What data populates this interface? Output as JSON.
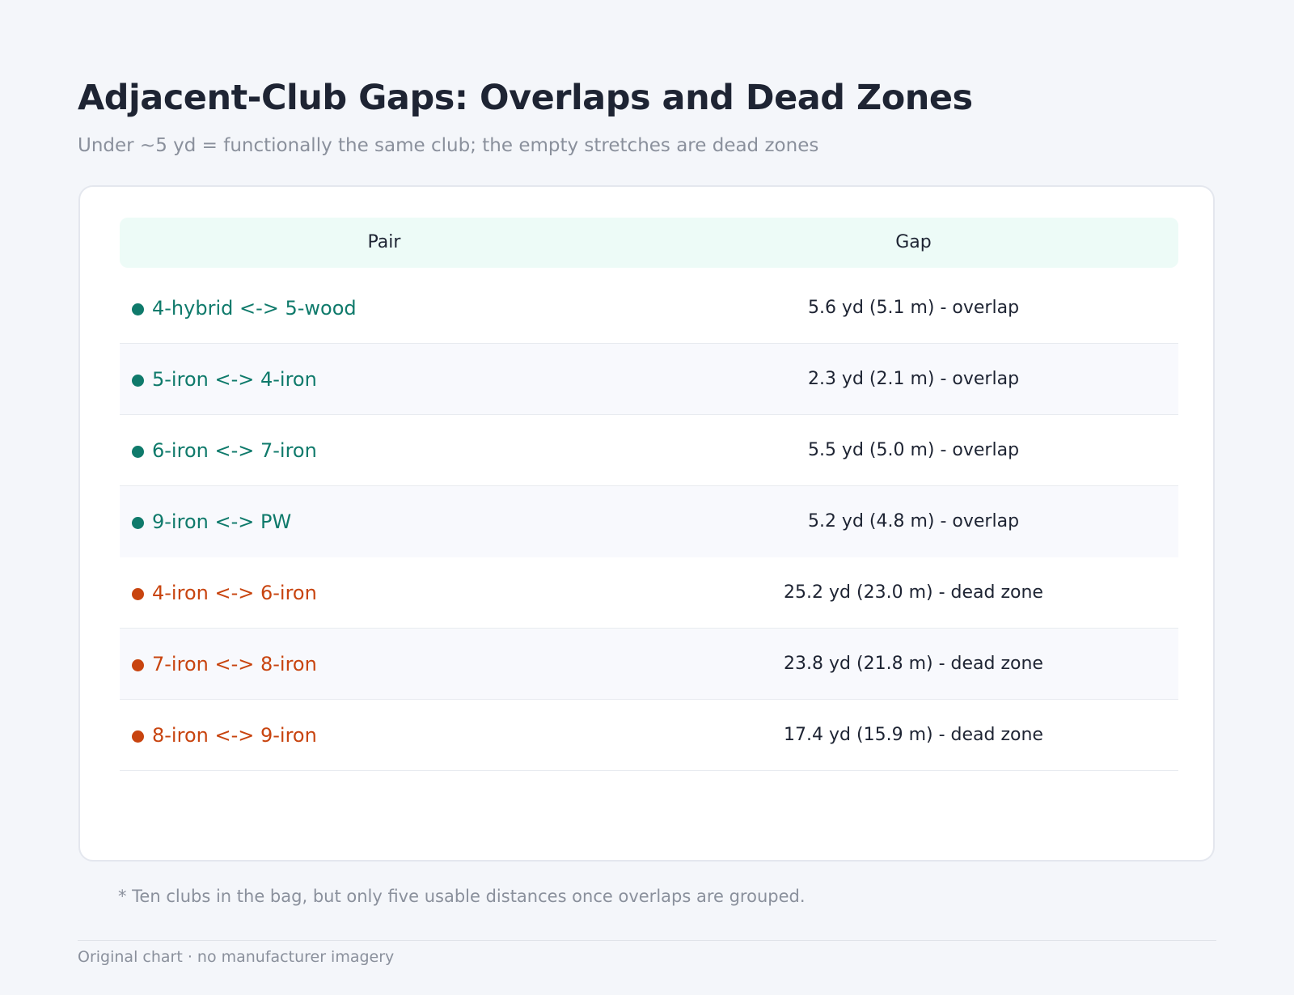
{
  "title": "Adjacent-Club Gaps: Overlaps and Dead Zones",
  "subtitle": "Under ~5 yd = functionally the same club; the empty stretches are dead zones",
  "colors": {
    "overlap": "#0f7a6b",
    "dead_zone": "#c8440f"
  },
  "chart_data": {
    "type": "table",
    "columns": [
      "Pair",
      "Gap"
    ],
    "rows": [
      {
        "pair": "4-hybrid <-> 5-wood",
        "gap": "5.6 yd (5.1 m) - overlap",
        "category": "overlap",
        "gap_yd": 5.6,
        "gap_m": 5.1
      },
      {
        "pair": "5-iron <-> 4-iron",
        "gap": "2.3 yd (2.1 m) - overlap",
        "category": "overlap",
        "gap_yd": 2.3,
        "gap_m": 2.1
      },
      {
        "pair": "6-iron <-> 7-iron",
        "gap": "5.5 yd (5.0 m) - overlap",
        "category": "overlap",
        "gap_yd": 5.5,
        "gap_m": 5.0
      },
      {
        "pair": "9-iron <-> PW",
        "gap": "5.2 yd (4.8 m) - overlap",
        "category": "overlap",
        "gap_yd": 5.2,
        "gap_m": 4.8
      },
      {
        "pair": "4-iron <-> 6-iron",
        "gap": "25.2 yd (23.0 m) - dead zone",
        "category": "dead_zone",
        "gap_yd": 25.2,
        "gap_m": 23.0
      },
      {
        "pair": "7-iron <-> 8-iron",
        "gap": "23.8 yd (21.8 m) - dead zone",
        "category": "dead_zone",
        "gap_yd": 23.8,
        "gap_m": 21.8
      },
      {
        "pair": "8-iron <-> 9-iron",
        "gap": "17.4 yd (15.9 m) - dead zone",
        "category": "dead_zone",
        "gap_yd": 17.4,
        "gap_m": 15.9
      }
    ]
  },
  "footnote": "* Ten clubs in the bag, but only five usable distances once overlaps are grouped.",
  "credit": "Original chart · no manufacturer imagery"
}
